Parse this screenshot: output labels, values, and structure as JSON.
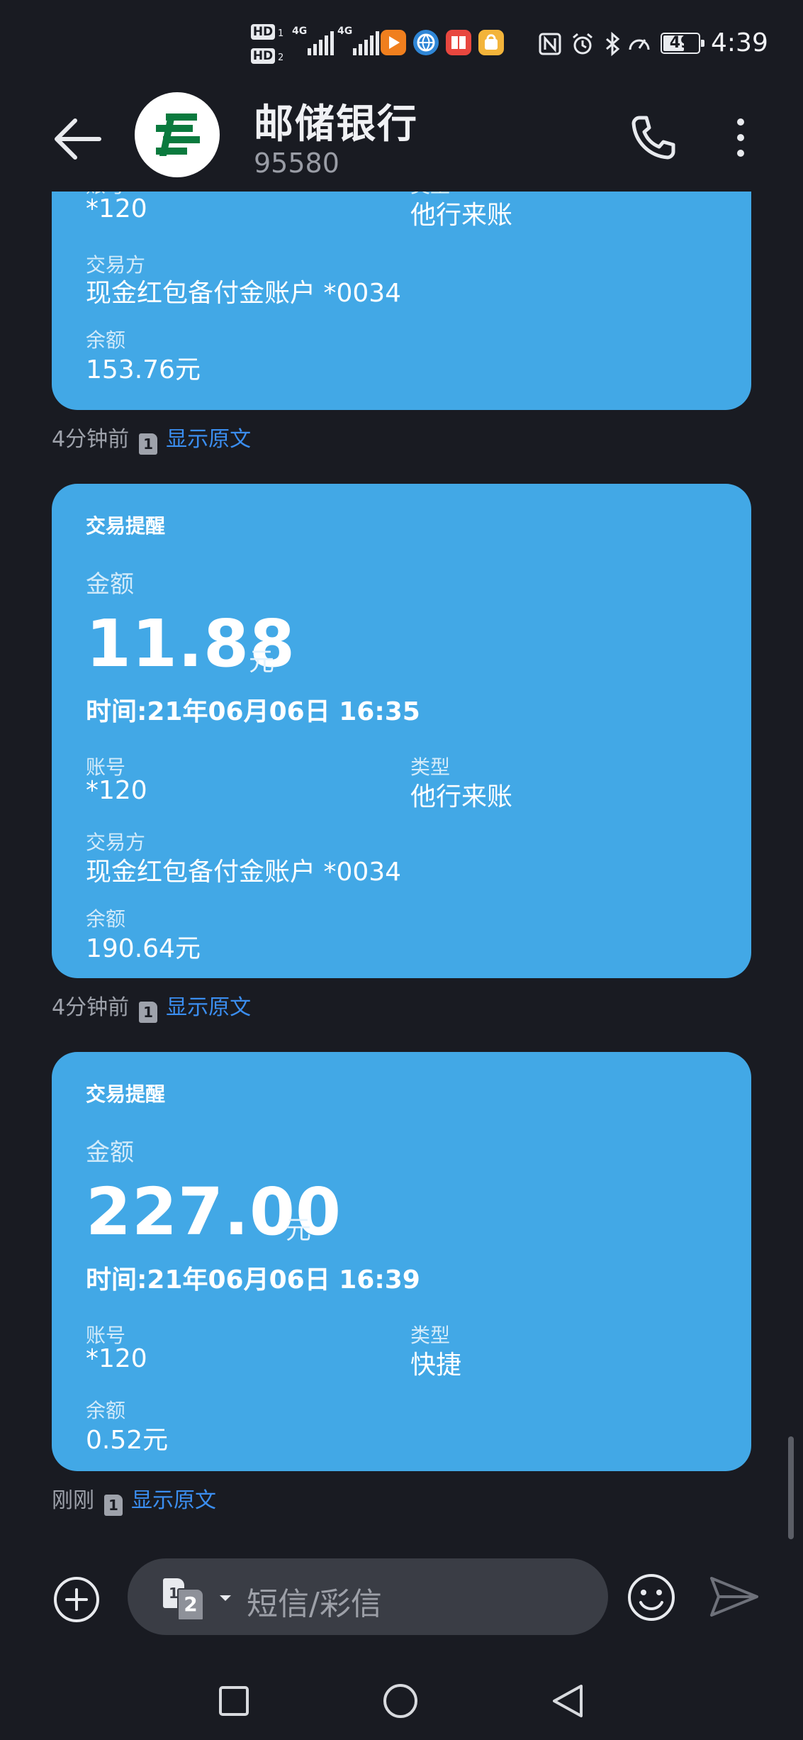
{
  "status_bar": {
    "hd1": "HD",
    "hd1_sub": "1",
    "hd2": "HD",
    "hd2_sub": "2",
    "sim1_net": "4G",
    "sim2_net": "4G",
    "battery": "49",
    "time": "4:39",
    "icons": [
      "video-app-icon",
      "browser-app-icon",
      "book-app-icon",
      "shop-app-icon",
      "nfc-icon",
      "alarm-icon",
      "bluetooth-icon",
      "speed-icon"
    ]
  },
  "header": {
    "title": "邮储银行",
    "number": "95580",
    "logo_color": "#0a7a3e"
  },
  "messages": [
    {
      "partial": true,
      "account": "*120",
      "type": "他行来账",
      "counterparty_label": "交易方",
      "counterparty": "现金红包备付金账户 *0034",
      "balance_label": "余额",
      "balance": "153.76元",
      "meta_time": "4分钟前",
      "sim": "1",
      "show_original": "显示原文"
    },
    {
      "title": "交易提醒",
      "amount_label": "金额",
      "amount": "11.88",
      "unit": "元",
      "time": "时间:21年06月06日 16:35",
      "account_label": "账号",
      "account": "*120",
      "type_label": "类型",
      "type": "他行来账",
      "counterparty_label": "交易方",
      "counterparty": "现金红包备付金账户 *0034",
      "balance_label": "余额",
      "balance": "190.64元",
      "meta_time": "4分钟前",
      "sim": "1",
      "show_original": "显示原文"
    },
    {
      "title": "交易提醒",
      "amount_label": "金额",
      "amount": "227.00",
      "unit": "元",
      "time": "时间:21年06月06日 16:39",
      "account_label": "账号",
      "account": "*120",
      "type_label": "类型",
      "type": "快捷",
      "balance_label": "余额",
      "balance": "0.52元",
      "meta_time": "刚刚",
      "sim": "1",
      "show_original": "显示原文"
    }
  ],
  "composer": {
    "sim_badge_back": "1",
    "sim_badge_front": "2",
    "placeholder": "短信/彩信"
  },
  "colors": {
    "background": "#191b22",
    "bubble": "#42a8e6",
    "link": "#3b8ef0"
  }
}
